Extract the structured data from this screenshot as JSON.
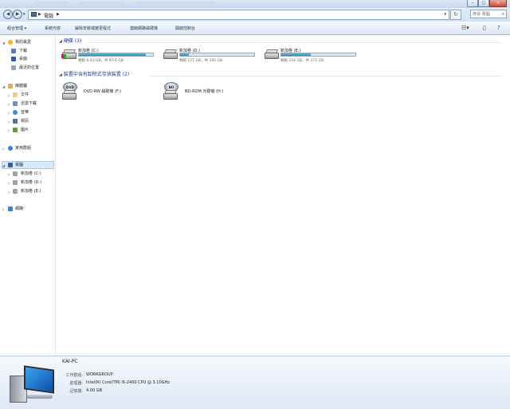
{
  "address": {
    "crumb": "電腦",
    "search_placeholder": "搜尋 電腦"
  },
  "window": {
    "minimize": "–",
    "maximize": "□",
    "close": "×"
  },
  "toolbar": {
    "organize": "組合管理 ▾",
    "system_properties": "系統內容",
    "uninstall": "解除安裝或變更程式",
    "map_drive": "連線網路磁碟機",
    "control_panel": "開啟控制台"
  },
  "sidebar": {
    "favorites": "我的最愛",
    "downloads": "下載",
    "desktop": "桌面",
    "recent": "最近的位置",
    "libraries": "媒體櫃",
    "documents": "文件",
    "pictures_dl": "迅雷下載",
    "music": "音樂",
    "videos": "視訊",
    "images": "圖片",
    "homegroup": "家用群組",
    "computer": "電腦",
    "drive_c": "新加卷 (C:)",
    "drive_d": "新加卷 (D:)",
    "drive_e": "新加卷 (E:)",
    "network": "網路"
  },
  "groups": {
    "hdd": "硬碟 (3)",
    "removable": "裝置中含有卸除式存放裝置 (2)"
  },
  "drives": [
    {
      "name": "新加卷 (C:)",
      "free": "剩餘 9.43 GB，共 97.6 GB",
      "used_fraction": 0.903
    },
    {
      "name": "新加卷 (D:)",
      "free": "剩餘 171 GB，共 195 GB",
      "used_fraction": 0.123
    },
    {
      "name": "新加卷 (E:)",
      "free": "剩餘 104 GB，共 172 GB",
      "used_fraction": 0.395
    }
  ],
  "optical": [
    {
      "name": "DVD RW 磁碟機 (F:)",
      "badge": "DVD"
    },
    {
      "name": "BD-ROM 光碟機 (H:)",
      "badge": "BD"
    }
  ],
  "details": {
    "pc_name": "KAI-PC",
    "workgroup_label": "工作群組:",
    "workgroup": "WORKGROUP",
    "cpu_label": "處理器:",
    "cpu": "Intel(R) Core(TM) i5-2400 CPU @ 3.10GHz",
    "ram_label": "記憶體:",
    "ram": "4.00 GB"
  }
}
